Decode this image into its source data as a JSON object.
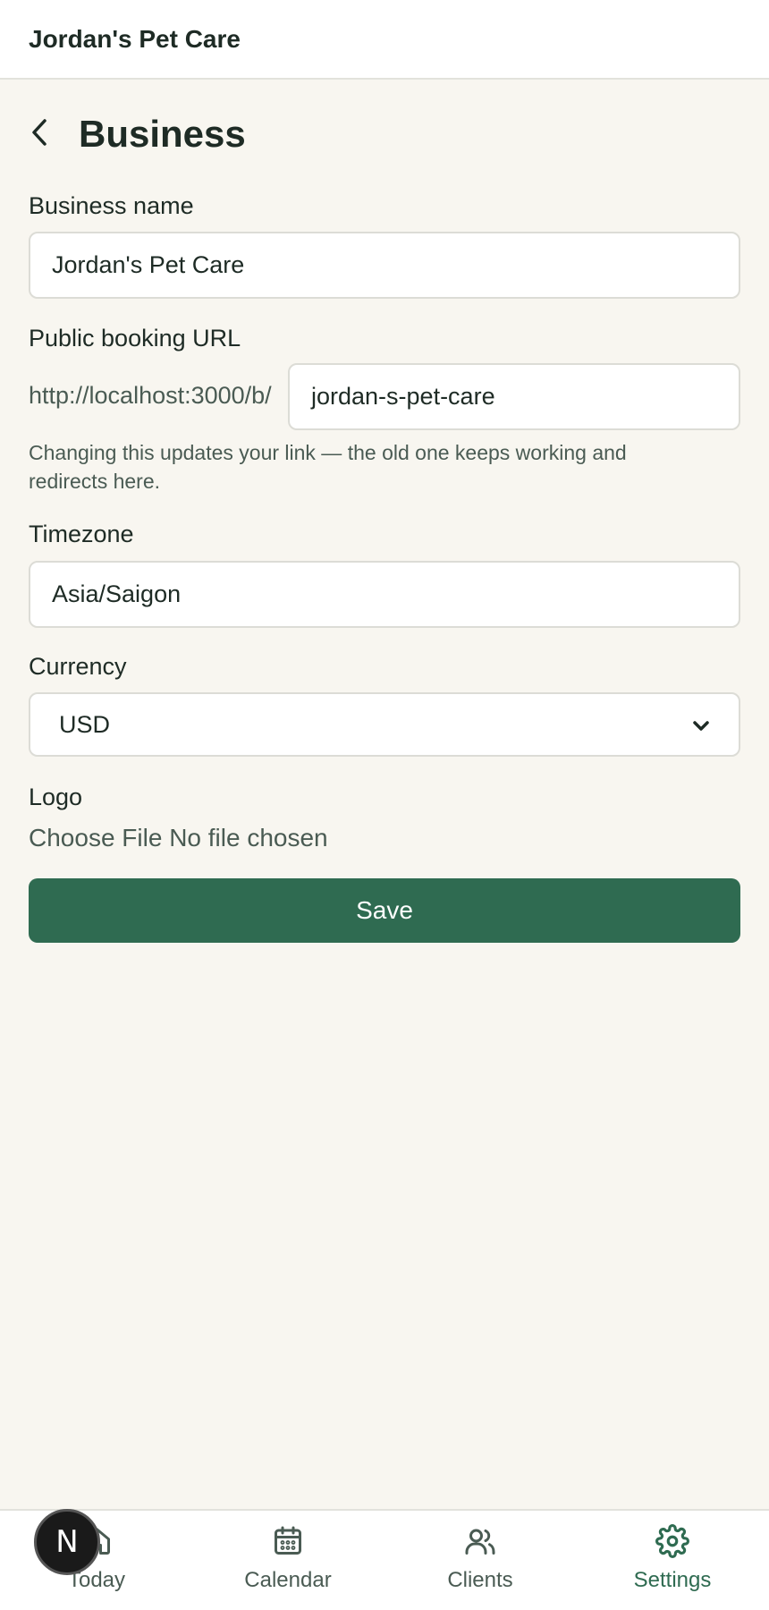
{
  "header": {
    "app_title": "Jordan's Pet Care"
  },
  "page": {
    "title": "Business",
    "back_icon": "chevron-left-icon"
  },
  "form": {
    "business_name": {
      "label": "Business name",
      "value": "Jordan's Pet Care"
    },
    "booking_url": {
      "label": "Public booking URL",
      "prefix": "http://localhost:3000/b/",
      "value": "jordan-s-pet-care",
      "help": "Changing this updates your link — the old one keeps working and redirects here."
    },
    "timezone": {
      "label": "Timezone",
      "value": "Asia/Saigon"
    },
    "currency": {
      "label": "Currency",
      "selected": "USD"
    },
    "logo": {
      "label": "Logo",
      "button": "Choose File",
      "status": "No file chosen"
    },
    "save_label": "Save"
  },
  "bottom_nav": {
    "items": [
      {
        "label": "Today",
        "icon": "home-icon",
        "active": false
      },
      {
        "label": "Calendar",
        "icon": "calendar-icon",
        "active": false
      },
      {
        "label": "Clients",
        "icon": "users-icon",
        "active": false
      },
      {
        "label": "Settings",
        "icon": "gear-icon",
        "active": true
      }
    ]
  },
  "dev_badge": {
    "letter": "N"
  },
  "colors": {
    "accent": "#2f6b51",
    "background": "#f8f6f0",
    "text": "#1e2b25",
    "muted": "#4a5b53"
  }
}
